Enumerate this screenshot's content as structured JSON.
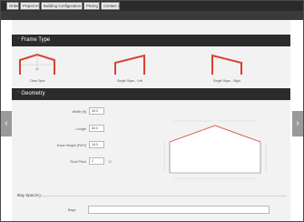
{
  "tabs": [
    "Order",
    "Project Info",
    "Building Configuration",
    "Pricing",
    "Contact Us"
  ],
  "sections": {
    "frame_type": "Frame Type",
    "geometry": "Geometry",
    "bay_spacing": "Bay Spacing"
  },
  "frame_types": [
    "Clear Span",
    "Single Slope - Left",
    "Single Slope - Right"
  ],
  "geometry_fields": [
    {
      "label": "Width (ft)",
      "value": "40.0",
      "unit": ""
    },
    {
      "label": "Length",
      "value": "60.0",
      "unit": ""
    },
    {
      "label": "Eave Height (Ft/Ft)",
      "value": "16.0",
      "unit": ""
    },
    {
      "label": "Roof Pitch",
      "value": "2",
      "unit": "12"
    }
  ],
  "bay_label": "Bays",
  "colors": {
    "accent": "#e23b2a",
    "header": "#2b2b2b"
  },
  "icons": {
    "left": "chevron-left-icon",
    "right": "chevron-right-icon",
    "star": "asterisk-icon"
  }
}
